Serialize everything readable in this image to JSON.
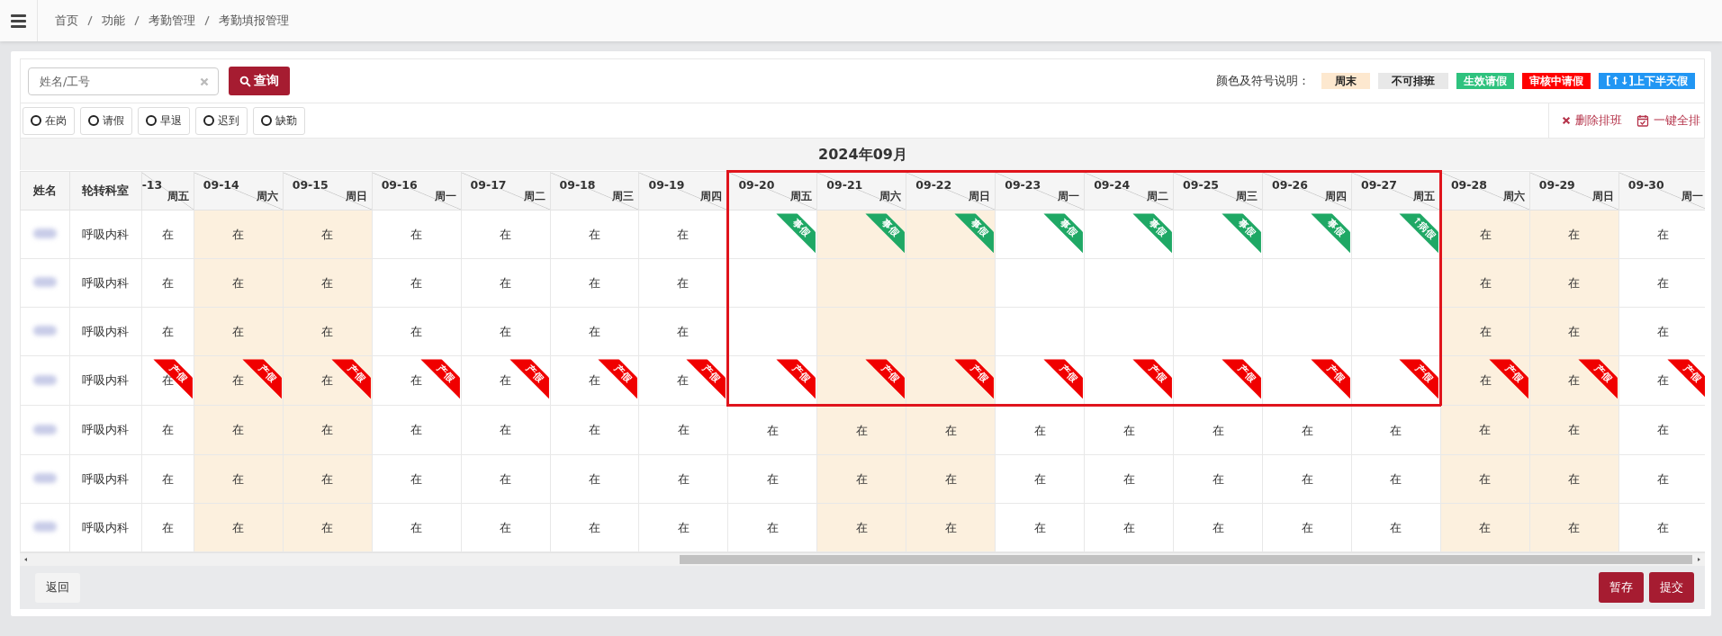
{
  "breadcrumb": [
    "首页",
    "功能",
    "考勤管理",
    "考勤填报管理"
  ],
  "search": {
    "placeholder": "姓名/工号",
    "button": "查询"
  },
  "legend": {
    "label": "颜色及符号说明：",
    "items": [
      {
        "label": "周末",
        "kind": "weekend"
      },
      {
        "label": "不可排班",
        "kind": "unavailable"
      },
      {
        "label": "生效请假",
        "kind": "approved"
      },
      {
        "label": "审核中请假",
        "kind": "pending"
      },
      {
        "label": "[↑↓]上下半天假",
        "kind": "halfday"
      }
    ]
  },
  "filters": [
    {
      "label": "在岗",
      "selected": false
    },
    {
      "label": "请假",
      "selected": false
    },
    {
      "label": "早退",
      "selected": false
    },
    {
      "label": "迟到",
      "selected": false
    },
    {
      "label": "缺勤",
      "selected": false
    }
  ],
  "actions": [
    {
      "label": "删除排班",
      "kind": "delete"
    },
    {
      "label": "一键全排",
      "kind": "schedule"
    }
  ],
  "table": {
    "month": "2024年09月",
    "columns": [
      "姓名",
      "轮转科室"
    ],
    "days": [
      {
        "date": "-13",
        "weekday": "周五",
        "weekend": false,
        "highlighted": false
      },
      {
        "date": "09-14",
        "weekday": "周六",
        "weekend": true,
        "highlighted": false
      },
      {
        "date": "09-15",
        "weekday": "周日",
        "weekend": true,
        "highlighted": false
      },
      {
        "date": "09-16",
        "weekday": "周一",
        "weekend": false,
        "highlighted": false
      },
      {
        "date": "09-17",
        "weekday": "周二",
        "weekend": false,
        "highlighted": false
      },
      {
        "date": "09-18",
        "weekday": "周三",
        "weekend": false,
        "highlighted": false
      },
      {
        "date": "09-19",
        "weekday": "周四",
        "weekend": false,
        "highlighted": false
      },
      {
        "date": "09-20",
        "weekday": "周五",
        "weekend": false,
        "highlighted": true
      },
      {
        "date": "09-21",
        "weekday": "周六",
        "weekend": true,
        "highlighted": true
      },
      {
        "date": "09-22",
        "weekday": "周日",
        "weekend": true,
        "highlighted": true
      },
      {
        "date": "09-23",
        "weekday": "周一",
        "weekend": false,
        "highlighted": true
      },
      {
        "date": "09-24",
        "weekday": "周二",
        "weekend": false,
        "highlighted": true
      },
      {
        "date": "09-25",
        "weekday": "周三",
        "weekend": false,
        "highlighted": true
      },
      {
        "date": "09-26",
        "weekday": "周四",
        "weekend": false,
        "highlighted": true
      },
      {
        "date": "09-27",
        "weekday": "周五",
        "weekend": false,
        "highlighted": true
      },
      {
        "date": "09-28",
        "weekday": "周六",
        "weekend": true,
        "highlighted": false
      },
      {
        "date": "09-29",
        "weekday": "周日",
        "weekend": true,
        "highlighted": false
      },
      {
        "date": "09-30",
        "weekday": "周一",
        "weekend": false,
        "highlighted": false
      }
    ],
    "rows": [
      {
        "dept": "呼吸内科",
        "highlighted": true,
        "cells": [
          {
            "text": "在"
          },
          {
            "text": "在"
          },
          {
            "text": "在"
          },
          {
            "text": "在"
          },
          {
            "text": "在"
          },
          {
            "text": "在"
          },
          {
            "text": "在"
          },
          {
            "tag": {
              "label": "事假",
              "kind": "approved"
            }
          },
          {
            "tag": {
              "label": "事假",
              "kind": "approved"
            }
          },
          {
            "tag": {
              "label": "事假",
              "kind": "approved"
            }
          },
          {
            "tag": {
              "label": "事假",
              "kind": "approved"
            }
          },
          {
            "tag": {
              "label": "事假",
              "kind": "approved"
            }
          },
          {
            "tag": {
              "label": "事假",
              "kind": "approved"
            }
          },
          {
            "tag": {
              "label": "事假",
              "kind": "approved"
            }
          },
          {
            "tag": {
              "label": "↑病假",
              "kind": "approved"
            }
          },
          {
            "text": "在"
          },
          {
            "text": "在"
          },
          {
            "text": "在"
          }
        ]
      },
      {
        "dept": "呼吸内科",
        "highlighted": true,
        "cells": [
          {
            "text": "在"
          },
          {
            "text": "在"
          },
          {
            "text": "在"
          },
          {
            "text": "在"
          },
          {
            "text": "在"
          },
          {
            "text": "在"
          },
          {
            "text": "在"
          },
          {},
          {},
          {},
          {},
          {},
          {},
          {},
          {},
          {
            "text": "在"
          },
          {
            "text": "在"
          },
          {
            "text": "在"
          }
        ]
      },
      {
        "dept": "呼吸内科",
        "highlighted": true,
        "cells": [
          {
            "text": "在"
          },
          {
            "text": "在"
          },
          {
            "text": "在"
          },
          {
            "text": "在"
          },
          {
            "text": "在"
          },
          {
            "text": "在"
          },
          {
            "text": "在"
          },
          {},
          {},
          {},
          {},
          {},
          {},
          {},
          {},
          {
            "text": "在"
          },
          {
            "text": "在"
          },
          {
            "text": "在"
          }
        ]
      },
      {
        "dept": "呼吸内科",
        "highlighted": true,
        "cells": [
          {
            "text": "在",
            "tag": {
              "label": "产假",
              "kind": "pending"
            }
          },
          {
            "text": "在",
            "tag": {
              "label": "产假",
              "kind": "pending"
            }
          },
          {
            "text": "在",
            "tag": {
              "label": "产假",
              "kind": "pending"
            }
          },
          {
            "text": "在",
            "tag": {
              "label": "产假",
              "kind": "pending"
            }
          },
          {
            "text": "在",
            "tag": {
              "label": "产假",
              "kind": "pending"
            }
          },
          {
            "text": "在",
            "tag": {
              "label": "产假",
              "kind": "pending"
            }
          },
          {
            "text": "在",
            "tag": {
              "label": "产假",
              "kind": "pending"
            }
          },
          {
            "tag": {
              "label": "产假",
              "kind": "pending"
            }
          },
          {
            "tag": {
              "label": "产假",
              "kind": "pending"
            }
          },
          {
            "tag": {
              "label": "产假",
              "kind": "pending"
            }
          },
          {
            "tag": {
              "label": "产假",
              "kind": "pending"
            }
          },
          {
            "tag": {
              "label": "产假",
              "kind": "pending"
            }
          },
          {
            "tag": {
              "label": "产假",
              "kind": "pending"
            }
          },
          {
            "tag": {
              "label": "产假",
              "kind": "pending"
            }
          },
          {
            "tag": {
              "label": "产假",
              "kind": "pending"
            }
          },
          {
            "text": "在",
            "tag": {
              "label": "产假",
              "kind": "pending"
            }
          },
          {
            "text": "在",
            "tag": {
              "label": "产假",
              "kind": "pending"
            }
          },
          {
            "text": "在",
            "tag": {
              "label": "产假",
              "kind": "pending"
            }
          }
        ]
      },
      {
        "dept": "呼吸内科",
        "highlighted": false,
        "cells": [
          {
            "text": "在"
          },
          {
            "text": "在"
          },
          {
            "text": "在"
          },
          {
            "text": "在"
          },
          {
            "text": "在"
          },
          {
            "text": "在"
          },
          {
            "text": "在"
          },
          {
            "text": "在"
          },
          {
            "text": "在"
          },
          {
            "text": "在"
          },
          {
            "text": "在"
          },
          {
            "text": "在"
          },
          {
            "text": "在"
          },
          {
            "text": "在"
          },
          {
            "text": "在"
          },
          {
            "text": "在"
          },
          {
            "text": "在"
          },
          {
            "text": "在"
          }
        ]
      },
      {
        "dept": "呼吸内科",
        "highlighted": false,
        "cells": [
          {
            "text": "在"
          },
          {
            "text": "在"
          },
          {
            "text": "在"
          },
          {
            "text": "在"
          },
          {
            "text": "在"
          },
          {
            "text": "在"
          },
          {
            "text": "在"
          },
          {
            "text": "在"
          },
          {
            "text": "在"
          },
          {
            "text": "在"
          },
          {
            "text": "在"
          },
          {
            "text": "在"
          },
          {
            "text": "在"
          },
          {
            "text": "在"
          },
          {
            "text": "在"
          },
          {
            "text": "在"
          },
          {
            "text": "在"
          },
          {
            "text": "在"
          }
        ]
      },
      {
        "dept": "呼吸内科",
        "highlighted": false,
        "cells": [
          {
            "text": "在"
          },
          {
            "text": "在"
          },
          {
            "text": "在"
          },
          {
            "text": "在"
          },
          {
            "text": "在"
          },
          {
            "text": "在"
          },
          {
            "text": "在"
          },
          {
            "text": "在"
          },
          {
            "text": "在"
          },
          {
            "text": "在"
          },
          {
            "text": "在"
          },
          {
            "text": "在"
          },
          {
            "text": "在"
          },
          {
            "text": "在"
          },
          {
            "text": "在"
          },
          {
            "text": "在"
          },
          {
            "text": "在"
          },
          {
            "text": "在"
          }
        ]
      }
    ]
  },
  "footer": {
    "back": "返回",
    "buttons": [
      "暂存",
      "提交"
    ]
  }
}
